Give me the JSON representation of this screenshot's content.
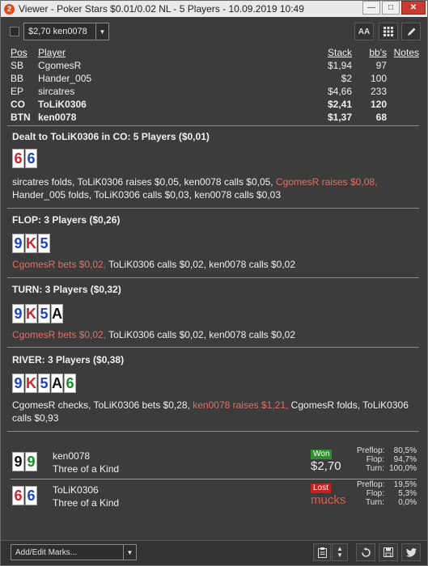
{
  "window": {
    "title": "Viewer - Poker Stars $0.01/0.02 NL - 5 Players - 10.09.2019 10:49",
    "app_icon": "2",
    "buttons": [
      "minimize-icon",
      "maximize-icon",
      "close-icon"
    ]
  },
  "toolbar": {
    "player_select_value": "$2,70 ken0078",
    "font_button_label": "AA",
    "grid_icon": "grid-icon",
    "edit_icon": "pencil-icon"
  },
  "players": {
    "headers": {
      "pos": "Pos",
      "player": "Player",
      "stack": "Stack",
      "bbs": "bb's",
      "notes": "Notes"
    },
    "rows": [
      {
        "pos": "SB",
        "player": "CgomesR",
        "stack": "$1,94",
        "bbs": "97",
        "bold": false
      },
      {
        "pos": "BB",
        "player": "Hander_005",
        "stack": "$2",
        "bbs": "100",
        "bold": false
      },
      {
        "pos": "EP",
        "player": "sircatres",
        "stack": "$4,66",
        "bbs": "233",
        "bold": false
      },
      {
        "pos": "CO",
        "player": "ToLiK0306",
        "stack": "$2,41",
        "bbs": "120",
        "bold": true
      },
      {
        "pos": "BTN",
        "player": "ken0078",
        "stack": "$1,37",
        "bbs": "68",
        "bold": true
      }
    ]
  },
  "preflop": {
    "title": "Dealt to ToLiK0306 in CO: 5 Players ($0,01)",
    "cards": [
      {
        "rank": "6",
        "suit": "h"
      },
      {
        "rank": "6",
        "suit": "d"
      }
    ],
    "line1": [
      {
        "text": "sircatres folds, ToLiK0306 raises $0,05, ken0078 calls $0,05, ",
        "red": false
      },
      {
        "text": "CgomesR raises $0,08,",
        "red": true
      }
    ],
    "line2": "Hander_005 folds, ToLiK0306 calls $0,03, ken0078 calls $0,03"
  },
  "flop": {
    "title": "FLOP: 3 Players ($0,26)",
    "cards": [
      {
        "rank": "9",
        "suit": "d"
      },
      {
        "rank": "K",
        "suit": "h"
      },
      {
        "rank": "5",
        "suit": "d"
      }
    ],
    "red_part": "CgomesR bets $0,02,",
    "rest": " ToLiK0306 calls $0,02, ken0078 calls $0,02"
  },
  "turn": {
    "title": "TURN: 3 Players ($0,32)",
    "cards": [
      {
        "rank": "9",
        "suit": "d"
      },
      {
        "rank": "K",
        "suit": "h"
      },
      {
        "rank": "5",
        "suit": "d"
      },
      {
        "rank": "A",
        "suit": "s"
      }
    ],
    "red_part": "CgomesR bets $0,02,",
    "rest": " ToLiK0306 calls $0,02, ken0078 calls $0,02"
  },
  "river": {
    "title": "RIVER: 3 Players ($0,38)",
    "cards": [
      {
        "rank": "9",
        "suit": "d"
      },
      {
        "rank": "K",
        "suit": "h"
      },
      {
        "rank": "5",
        "suit": "d"
      },
      {
        "rank": "A",
        "suit": "s"
      },
      {
        "rank": "6",
        "suit": "c"
      }
    ],
    "part1": "CgomesR checks, ToLiK0306 bets $0,28, ",
    "red_part": "ken0078 raises $1,21,",
    "part2": " CgomesR folds, ToLiK0306",
    "line2": "calls $0,93"
  },
  "results": [
    {
      "player": "ken0078",
      "hand": "Three of a Kind",
      "cards": [
        {
          "rank": "9",
          "suit": "s"
        },
        {
          "rank": "9",
          "suit": "c"
        }
      ],
      "status": "Won",
      "amount": "$2,70",
      "won": true,
      "stats": [
        {
          "label": "Preflop:",
          "value": "80,5%"
        },
        {
          "label": "Flop:",
          "value": "94,7%"
        },
        {
          "label": "Turn:",
          "value": "100,0%"
        }
      ]
    },
    {
      "player": "ToLiK0306",
      "hand": "Three of a Kind",
      "cards": [
        {
          "rank": "6",
          "suit": "h"
        },
        {
          "rank": "6",
          "suit": "d"
        }
      ],
      "status": "Lost",
      "amount": "mucks",
      "won": false,
      "stats": [
        {
          "label": "Preflop:",
          "value": "19,5%"
        },
        {
          "label": "Flop:",
          "value": "5,3%"
        },
        {
          "label": "Turn:",
          "value": "0,0%"
        }
      ]
    }
  ],
  "bottom": {
    "marks_placeholder": "Add/Edit Marks...",
    "icons": [
      "clipboard-icon",
      "updown-icon",
      "replay-icon",
      "save-icon",
      "twitter-icon"
    ]
  },
  "colors": {
    "background": "#3c3c3c",
    "red_action": "#e07064",
    "won": "#2f8f2f",
    "lost": "#c82020"
  }
}
